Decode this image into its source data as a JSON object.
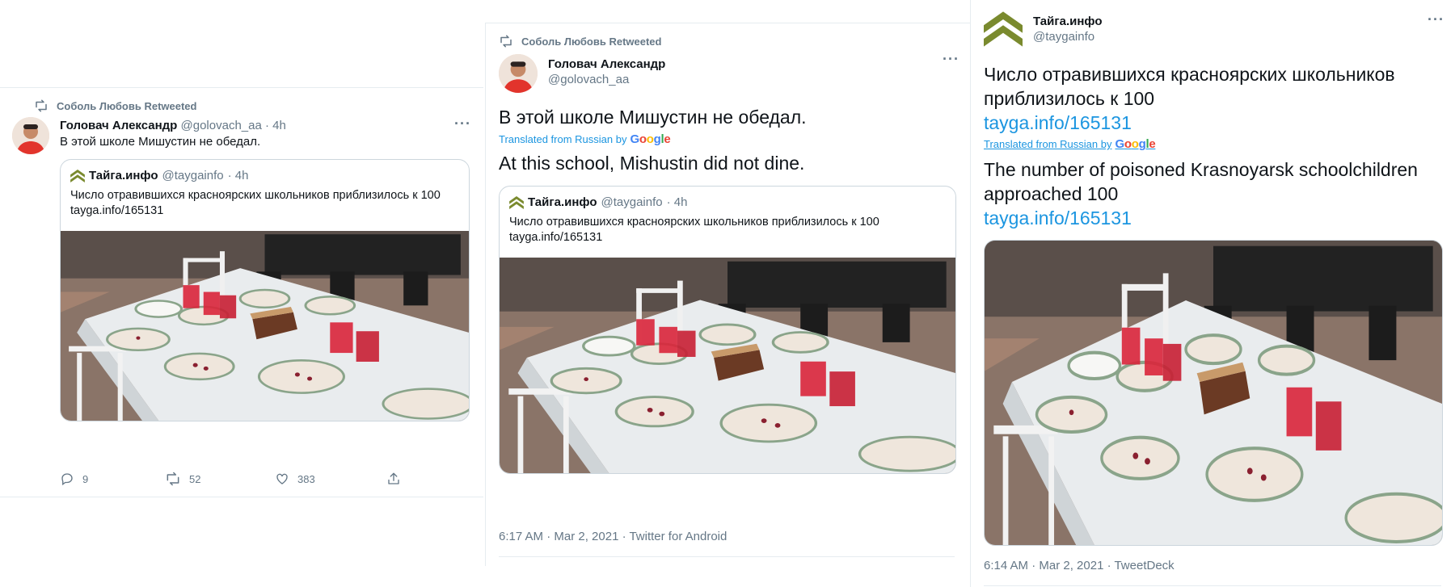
{
  "colors": {
    "accent": "#1b95e0",
    "muted": "#657786",
    "border": "#e6ecf0"
  },
  "panel1": {
    "retweeted_by": "Соболь Любовь Retweeted",
    "author_name": "Головач Александр",
    "author_handle": "@golovach_aa",
    "time": "· 4h",
    "text": "В этой школе Мишустин не обедал.",
    "quote": {
      "name": "Тайга.инфо",
      "handle": "@taygainfo",
      "time": "· 4h",
      "text_line1": "Число отравившихся красноярских школьников приблизилось к 100",
      "text_line2": "tayga.info/165131"
    },
    "actions": {
      "replies": "9",
      "retweets": "52",
      "likes": "383"
    },
    "icons": [
      "retweet-icon",
      "more-icon",
      "reply-icon",
      "like-icon",
      "share-icon"
    ]
  },
  "panel2": {
    "retweeted_by": "Соболь Любовь Retweeted",
    "author_name": "Головач Александр",
    "author_handle": "@golovach_aa",
    "text": "В этой школе Мишустин не обедал.",
    "translated_label": "Translated from Russian by",
    "google": "Google",
    "translation": "At this school, Mishustin did not dine.",
    "quote": {
      "name": "Тайга.инфо",
      "handle": "@taygainfo",
      "time": "· 4h",
      "text_line1": "Число отравившихся красноярских школьников приблизилось к 100",
      "text_line2": "tayga.info/165131"
    },
    "meta": "6:17 AM · Mar 2, 2021 · Twitter for Android"
  },
  "panel3": {
    "author_name": "Тайга.инфо",
    "author_handle": "@taygainfo",
    "text_line1": "Число отравившихся красноярских школьников",
    "text_line2": "приблизилось к 100",
    "link": "tayga.info/165131",
    "translated_label": "Translated from Russian by",
    "google": "Google",
    "translation_line1": "The number of poisoned Krasnoyarsk schoolchildren",
    "translation_line2": "approached 100",
    "translation_link": "tayga.info/165131",
    "meta": "6:14 AM · Mar 2, 2021 · TweetDeck"
  }
}
